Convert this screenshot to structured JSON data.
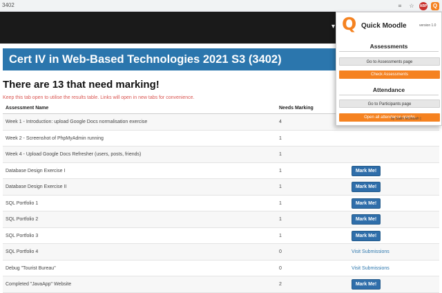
{
  "browser": {
    "url": "3402"
  },
  "course": {
    "title": "Cert IV in Web-Based Technologies 2021 S3 (3402)"
  },
  "main": {
    "heading": "There are 13 that need marking!",
    "note": "Keep this tab open to utilise the results table. Links will open in new tabs for convenience.",
    "columns": {
      "name": "Assessment Name",
      "marking": "Needs Marking"
    },
    "rows": [
      {
        "name": "Week 1 - Introduction: upload Google Docs normalisation exercise",
        "count": "4",
        "action": ""
      },
      {
        "name": "Week 2 - Screenshot of PhpMyAdmin running",
        "count": "1",
        "action": ""
      },
      {
        "name": "Week 4 - Upload Google Docs Refresher (users, posts, friends)",
        "count": "1",
        "action": ""
      },
      {
        "name": "Database Design Exercise I",
        "count": "1",
        "action": "Mark Me!"
      },
      {
        "name": "Database Design Exercise II",
        "count": "1",
        "action": "Mark Me!"
      },
      {
        "name": "SQL Portfolio 1",
        "count": "1",
        "action": "Mark Me!"
      },
      {
        "name": "SQL Portfolio 2",
        "count": "1",
        "action": "Mark Me!"
      },
      {
        "name": "SQL Portfolio 3",
        "count": "1",
        "action": "Mark Me!"
      },
      {
        "name": "SQL Portfolio 4",
        "count": "0",
        "action": "Visit Submissions"
      },
      {
        "name": "Debug \"Tourist Bureau\"",
        "count": "0",
        "action": "Visit Submissions"
      },
      {
        "name": "Completed \"JavaApp\" Website",
        "count": "2",
        "action": "Mark Me!"
      }
    ]
  },
  "popup": {
    "logo_letter": "Q",
    "title": "Quick Moodle",
    "version": "version 1.0",
    "assessments_label": "Assessments",
    "goto_assessments": "Go to Assessments page",
    "check_assessments": "Check Assessments",
    "attendance_label": "Attendance",
    "goto_participants": "Go to Participants page",
    "open_graphs": "Open all attendance graphs",
    "footer_by": "by Salim McIntosh |",
    "footer_feedback": "Feedback"
  },
  "colors": {
    "accent": "#f58220",
    "banner": "#2b76ad",
    "button": "#2f6eaa"
  }
}
